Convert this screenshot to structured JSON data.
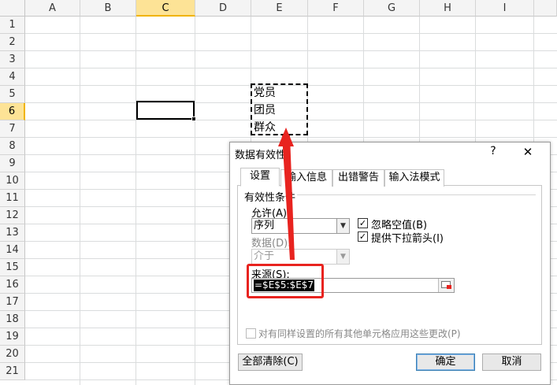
{
  "sheet": {
    "columns": [
      "A",
      "B",
      "C",
      "D",
      "E",
      "F",
      "G",
      "H",
      "I"
    ],
    "selected_column": "C",
    "rows": [
      "1",
      "2",
      "3",
      "4",
      "5",
      "6",
      "7",
      "8",
      "9",
      "10",
      "11",
      "12",
      "13",
      "14",
      "15",
      "16",
      "17",
      "18",
      "19",
      "20",
      "21"
    ],
    "selected_row": "6",
    "cells": {
      "E5": "党员",
      "E6": "团员",
      "E7": "群众"
    }
  },
  "dialog": {
    "title": "数据有效性",
    "help": "?",
    "close": "✕",
    "tabs": [
      "设置",
      "输入信息",
      "出错警告",
      "输入法模式"
    ],
    "group_label": "有效性条件",
    "allow_label": "允许(A):",
    "allow_value": "序列",
    "data_label": "数据(D):",
    "data_value": "介于",
    "ignore_blank_label": "忽略空值(B)",
    "ignore_blank_checked": "☑",
    "dropdown_label": "提供下拉箭头(I)",
    "dropdown_checked": "☑",
    "source_label": "来源(S):",
    "source_value": "=$E$5:$E$7",
    "apply_all_label": "对有同样设置的所有其他单元格应用这些更改(P)",
    "clear_all": "全部清除(C)",
    "ok": "确定",
    "cancel": "取消"
  },
  "colors": {
    "highlight": "#e8231f",
    "header_selected": "#fde396"
  }
}
